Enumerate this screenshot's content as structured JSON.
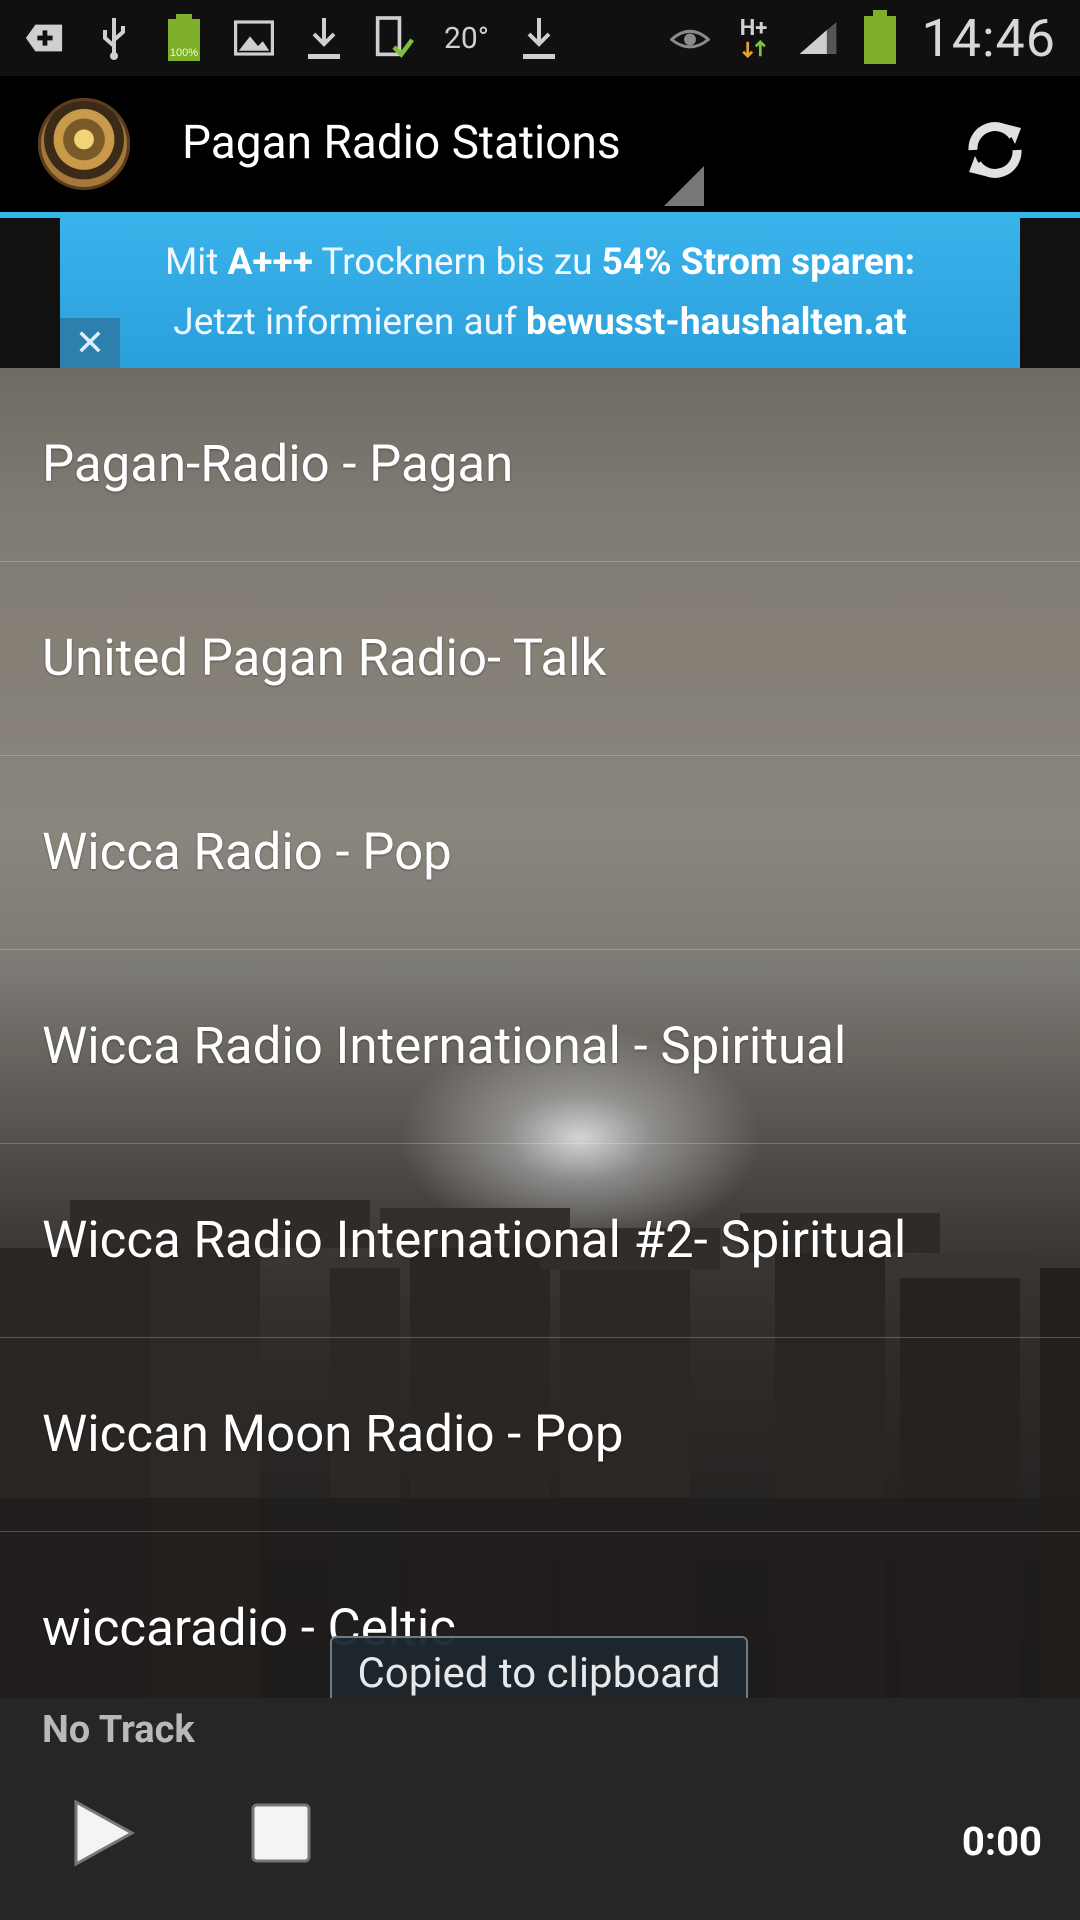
{
  "status_bar": {
    "temperature": "20°",
    "time": "14:46",
    "battery_small_label": "100%",
    "network_label": "H+"
  },
  "app": {
    "title": "Pagan Radio Stations"
  },
  "ad": {
    "line1_pre": "Mit ",
    "line1_bold1": "A+++",
    "line1_mid": " Trocknern bis zu ",
    "line1_bold2": "54%",
    "line1_bold3": " Strom sparen:",
    "line2_pre": "Jetzt informieren auf ",
    "line2_bold": "bewusst-haushalten.at",
    "close_glyph": "✕"
  },
  "stations": [
    "Pagan-Radio - Pagan",
    "United Pagan Radio- Talk",
    "Wicca Radio - Pop",
    "Wicca Radio International - Spiritual",
    "Wicca Radio International #2- Spiritual",
    "Wiccan Moon Radio - Pop",
    "wiccaradio - Celtic"
  ],
  "toast": {
    "text": "Copied to clipboard"
  },
  "player": {
    "track": "No Track",
    "time": "0:00"
  },
  "colors": {
    "accent": "#33b5e5",
    "ad_blue": "#2aa0dc",
    "player_bg": "#262626"
  }
}
